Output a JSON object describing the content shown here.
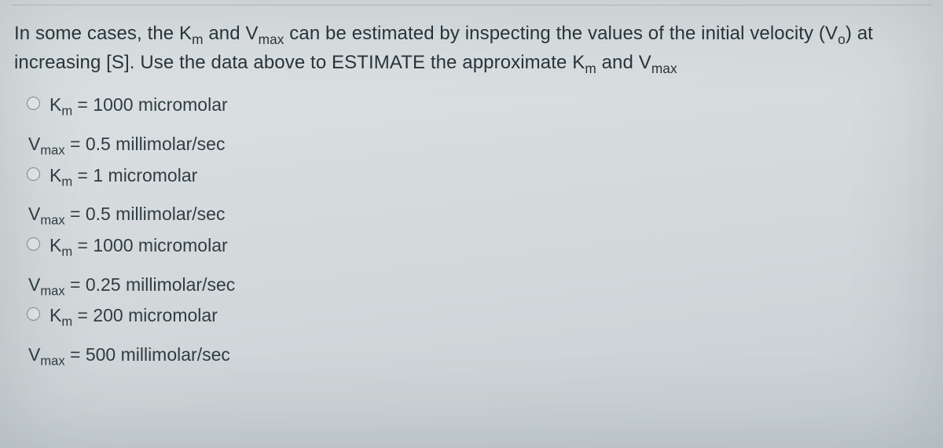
{
  "question": {
    "pre1": "In some cases, the K",
    "sub_m1": "m",
    "mid1": " and V",
    "sub_max1": "max",
    "mid2": " can be estimated by inspecting the values of the initial velocity (V",
    "sub_o": "o",
    "mid3": ") at increasing [S]. Use the data above to ESTIMATE the approximate K",
    "sub_m2": "m",
    "mid4": " and V",
    "sub_max2": "max"
  },
  "options": [
    {
      "km_pre": "K",
      "km_sub": "m",
      "km_rest": " = 1000 micromolar",
      "vmax_pre": "V",
      "vmax_sub": "max",
      "vmax_rest": " = 0.5 millimolar/sec"
    },
    {
      "km_pre": "K",
      "km_sub": "m",
      "km_rest": " = 1 micromolar",
      "vmax_pre": "V",
      "vmax_sub": "max",
      "vmax_rest": " = 0.5 millimolar/sec"
    },
    {
      "km_pre": "K",
      "km_sub": "m",
      "km_rest": " = 1000 micromolar",
      "vmax_pre": "V",
      "vmax_sub": "max",
      "vmax_rest": " = 0.25 millimolar/sec"
    },
    {
      "km_pre": "K",
      "km_sub": "m",
      "km_rest": " = 200 micromolar",
      "vmax_pre": "V",
      "vmax_sub": "max",
      "vmax_rest": " = 500 millimolar/sec"
    }
  ]
}
